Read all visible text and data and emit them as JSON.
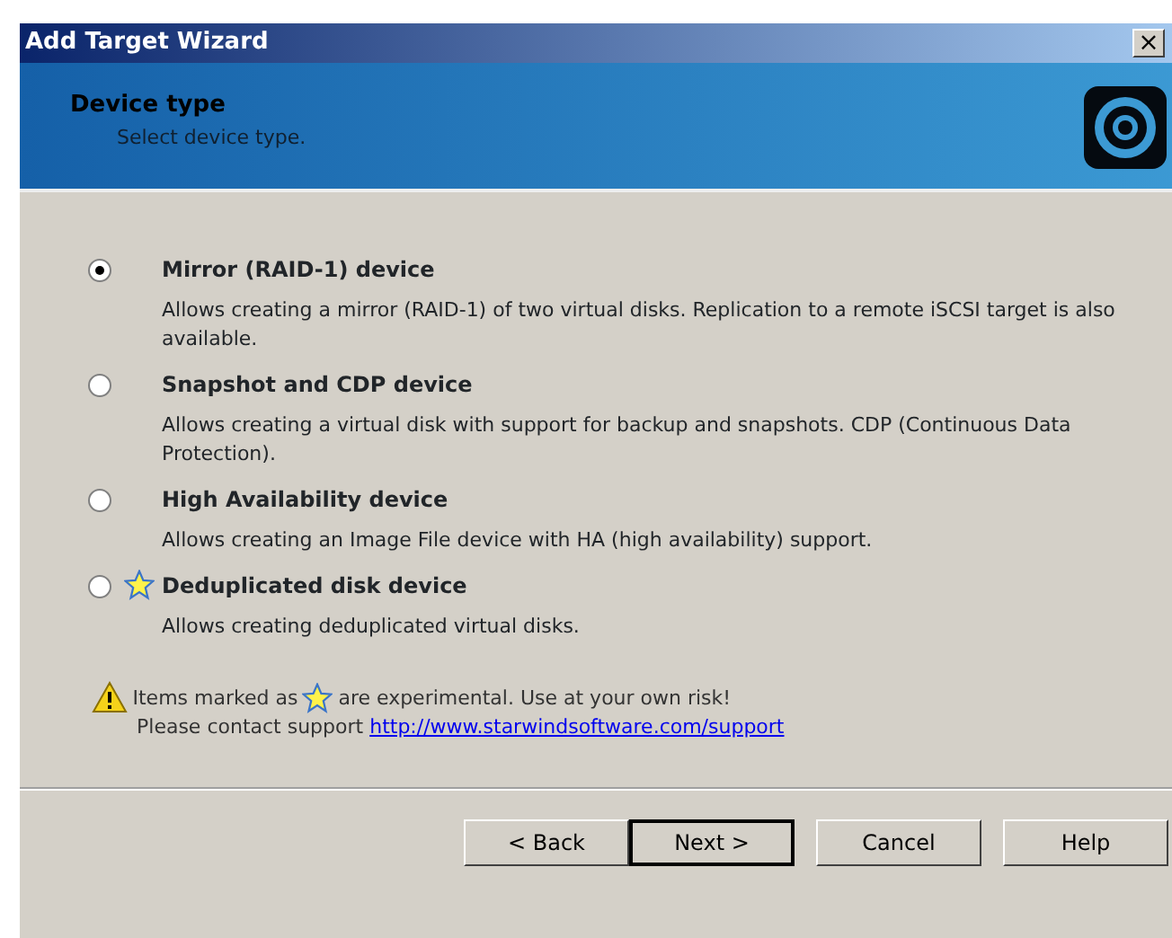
{
  "window": {
    "title": "Add Target Wizard",
    "close": "×"
  },
  "header": {
    "title": "Device type",
    "subtitle": "Select device type."
  },
  "options": [
    {
      "label": "Mirror (RAID-1) device",
      "description": "Allows creating a mirror (RAID-1) of two virtual disks. Replication to a remote iSCSI target is also available.",
      "selected": true,
      "experimental": false
    },
    {
      "label": "Snapshot and CDP device",
      "description": "Allows creating a virtual disk with support for backup and snapshots. CDP (Continuous Data Protection).",
      "selected": false,
      "experimental": false
    },
    {
      "label": "High Availability device",
      "description": "Allows creating an Image File device with HA (high availability) support.",
      "selected": false,
      "experimental": false
    },
    {
      "label": "Deduplicated disk device",
      "description": "Allows creating deduplicated virtual disks.",
      "selected": false,
      "experimental": true
    }
  ],
  "notice": {
    "before": "Items marked as",
    "after": "are experimental. Use at your own risk!",
    "contact": "Please contact support",
    "link": "http://www.starwindsoftware.com/support"
  },
  "buttons": [
    {
      "label": "< Back",
      "default": false
    },
    {
      "label": "Next >",
      "default": true
    },
    {
      "label": "Cancel",
      "default": false
    },
    {
      "label": "Help",
      "default": false
    }
  ]
}
